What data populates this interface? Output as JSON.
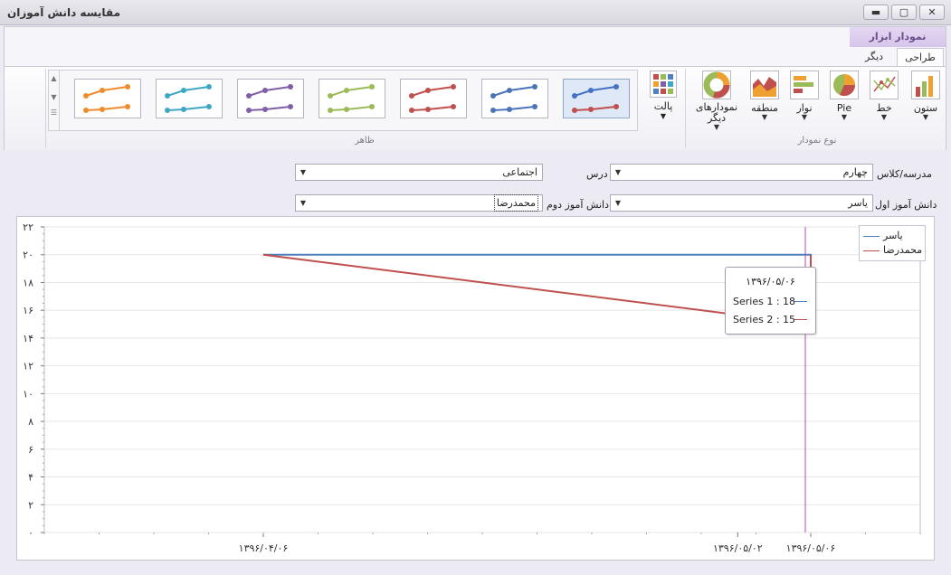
{
  "window": {
    "title": "مقایسه دانش آموزان",
    "min": "▬",
    "max": "▢",
    "close": "✕"
  },
  "ribbon": {
    "context_header": "نمودار ابزار",
    "tabs": [
      "طراحی",
      "دیگر"
    ],
    "chart_type_group": "نوع نمودار",
    "appearance_group": "ظاهر",
    "buttons": {
      "column": "ستون",
      "line": "خط",
      "pie": "Pie",
      "bar": "نوار",
      "area": "منطقه",
      "other": "نمودارهای دیگر",
      "palette": "پالت"
    },
    "style_colors": [
      "#4472c4",
      "#4a73b8",
      "#c0504d",
      "#9bbb59",
      "#7f5fa6",
      "#3fa7c4",
      "#f08a2c"
    ]
  },
  "filters": {
    "school_label": "مدرسه/کلاس",
    "school_value": "چهارم",
    "course_label": "درس",
    "course_value": "اجتماعی",
    "student1_label": "دانش آموز اول",
    "student1_value": "یاسر",
    "student2_label": "دانش آموز دوم",
    "student2_value": "محمدرضا"
  },
  "tooltip": {
    "header": "۱۳۹۶/۰۵/۰۶",
    "line1": "Series 1 : 18",
    "line2": "Series 2 : 15"
  },
  "chart_data": {
    "type": "line",
    "x": [
      "۱۳۹۶/۰۴/۰۶",
      "۱۳۹۶/۰۵/۰۲",
      "۱۳۹۶/۰۵/۰۶"
    ],
    "x_positions_days": [
      0,
      26,
      30
    ],
    "ylim": [
      0,
      22
    ],
    "yticks": [
      0,
      2,
      4,
      6,
      8,
      10,
      12,
      14,
      16,
      18,
      20,
      22
    ],
    "ytick_labels": [
      "۰",
      "۲",
      "۴",
      "۶",
      "۸",
      "۱۰",
      "۱۲",
      "۱۴",
      "۱۶",
      "۱۸",
      "۲۰",
      "۲۲"
    ],
    "grid": true,
    "legend": "right",
    "series": [
      {
        "name": "یاسر",
        "color": "#4f81bd",
        "points": [
          [
            0,
            20
          ],
          [
            26,
            20
          ],
          [
            30,
            20
          ],
          [
            30,
            18
          ]
        ]
      },
      {
        "name": "محمدرضا",
        "color": "#c0504d",
        "points": [
          [
            0,
            20
          ],
          [
            30,
            15
          ],
          [
            30,
            20
          ]
        ]
      }
    ],
    "crosshair_x": 30
  }
}
